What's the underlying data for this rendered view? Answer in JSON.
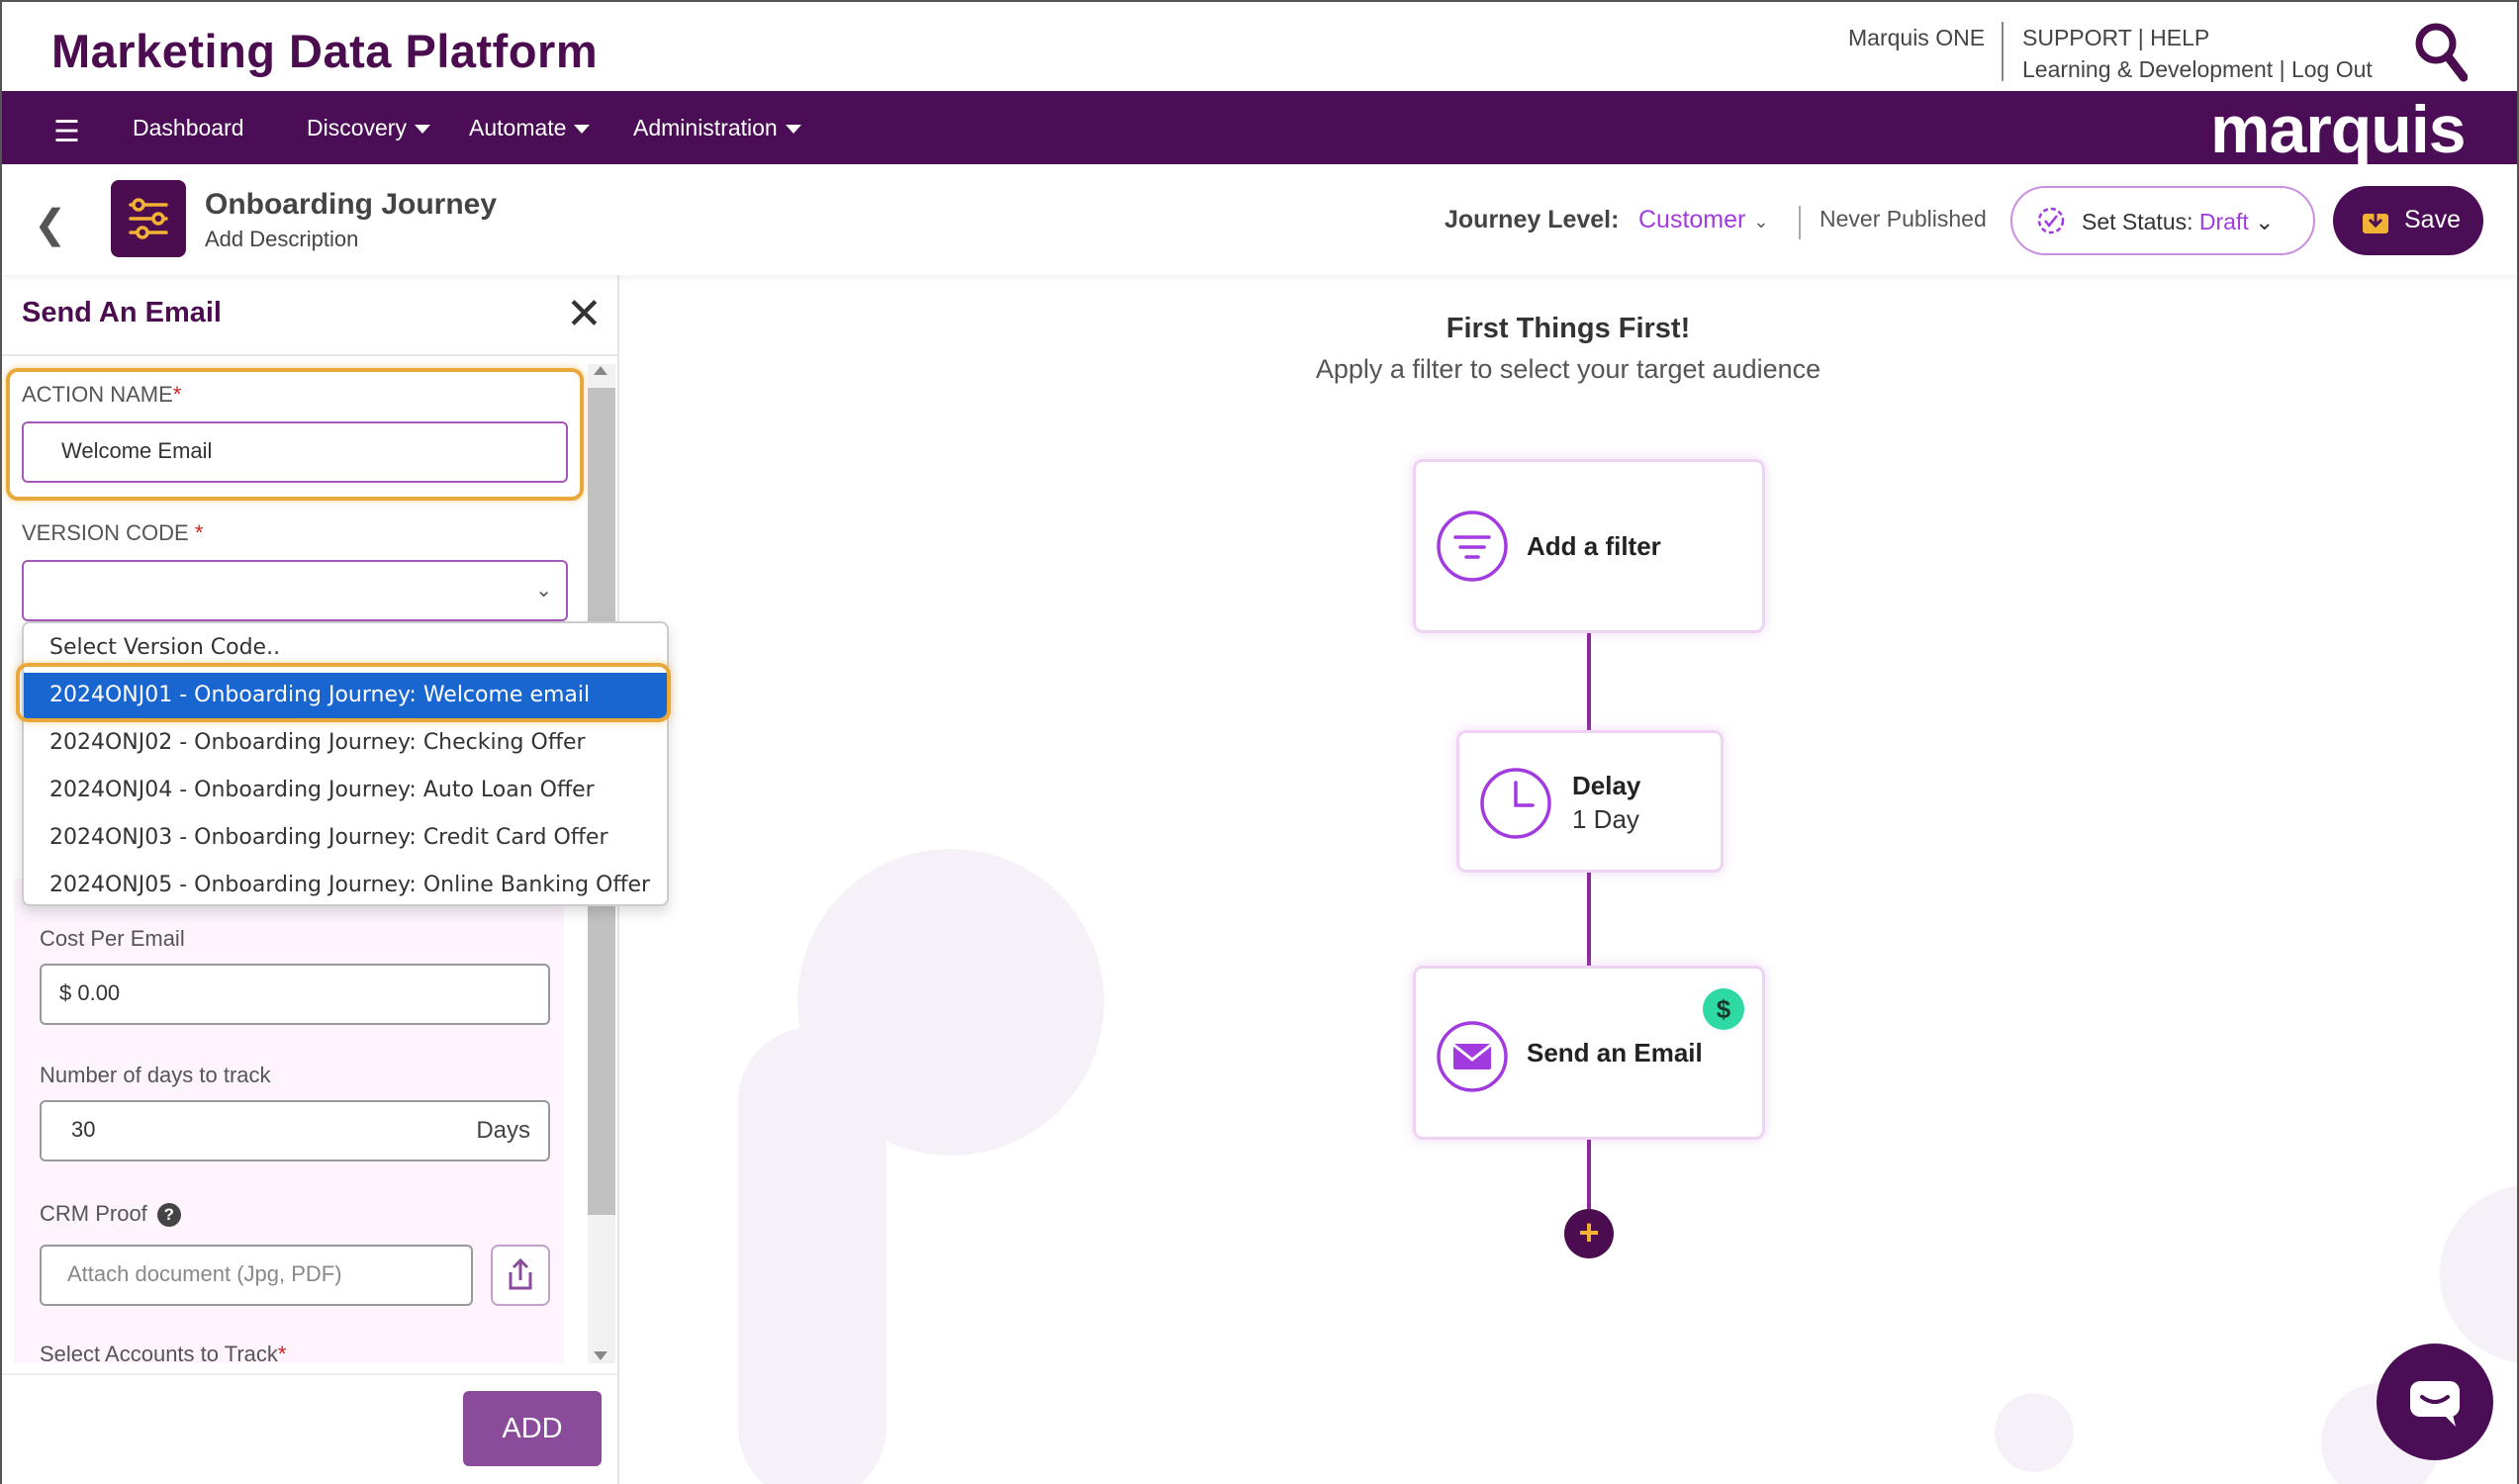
{
  "header": {
    "brand": "Marketing Data Platform",
    "link_marquis_one": "Marquis ONE",
    "link_support": "SUPPORT",
    "link_help": "HELP",
    "link_learning": "Learning & Development",
    "link_logout": "Log Out",
    "sep": "|"
  },
  "nav": {
    "dashboard": "Dashboard",
    "discovery": "Discovery",
    "automate": "Automate",
    "administration": "Administration",
    "logo": "marquis"
  },
  "journey": {
    "title": "Onboarding Journey",
    "description": "Add Description",
    "level_label": "Journey Level:",
    "level_value": "Customer",
    "publish_state": "Never Published",
    "status_label": "Set Status:",
    "status_value": "Draft",
    "save_label": "Save"
  },
  "panel": {
    "title": "Send An Email",
    "action_name_label": "ACTION NAME",
    "action_name_value": "Welcome Email",
    "version_code_label": "VERSION CODE",
    "version_code_value": "",
    "cost_label": "Cost Per Email",
    "cost_value": "$ 0.00",
    "days_label": "Number of days to track",
    "days_value": "30",
    "days_suffix": "Days",
    "crm_label": "CRM Proof",
    "crm_placeholder": "Attach document (Jpg, PDF)",
    "accounts_label": "Select Accounts to Track",
    "add_label": "ADD",
    "required_mark": "*"
  },
  "version_dropdown": {
    "options": [
      "Select Version Code..",
      "2024ONJ01 - Onboarding Journey: Welcome email",
      "2024ONJ02 - Onboarding Journey: Checking Offer",
      "2024ONJ04 - Onboarding Journey: Auto Loan Offer",
      "2024ONJ03 - Onboarding Journey: Credit Card Offer",
      "2024ONJ05 - Onboarding Journey: Online Banking Offer"
    ],
    "selected_index": 1
  },
  "canvas": {
    "title": "First Things First!",
    "subtitle": "Apply a filter to select your target audience",
    "nodes": {
      "filter": "Add a filter",
      "delay_label": "Delay",
      "delay_value": "1 Day",
      "email": "Send an Email",
      "email_badge": "$"
    },
    "add_step": "+"
  },
  "colors": {
    "brand_purple": "#4b0d56",
    "accent_purple": "#a13be0",
    "highlight_orange": "#e8a93a",
    "selected_blue": "#1a66d0",
    "badge_green": "#2fd9a3"
  }
}
